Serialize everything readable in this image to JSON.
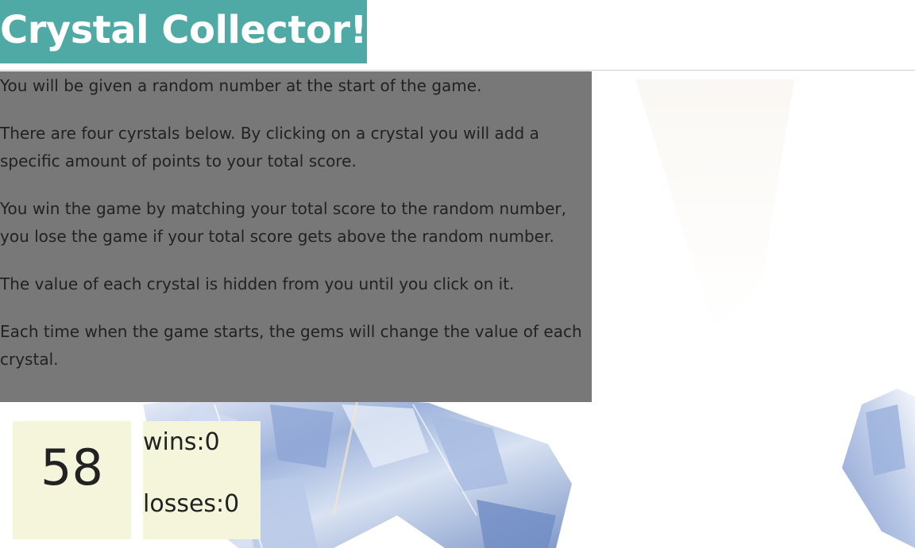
{
  "header": {
    "title": "Crystal Collector!"
  },
  "instructions": {
    "paragraphs": [
      "You will be given a random number at the start of the game.",
      "There are four cyrstals below. By clicking on a crystal you will add a specific amount of points to your total score.",
      "You win the game by matching your total score to the random number, you lose the game if your total score gets above the random number.",
      "The value of each crystal is hidden from you until you click on it.",
      "Each time when the game starts, the gems will change the value of each crystal."
    ]
  },
  "game": {
    "random_number": "58",
    "wins_label": "wins:0",
    "losses_label": "losses:0"
  },
  "colors": {
    "title_background": "#4fa9a4",
    "instructions_background": "#787878",
    "stat_box_background": "#f5f5dc"
  }
}
